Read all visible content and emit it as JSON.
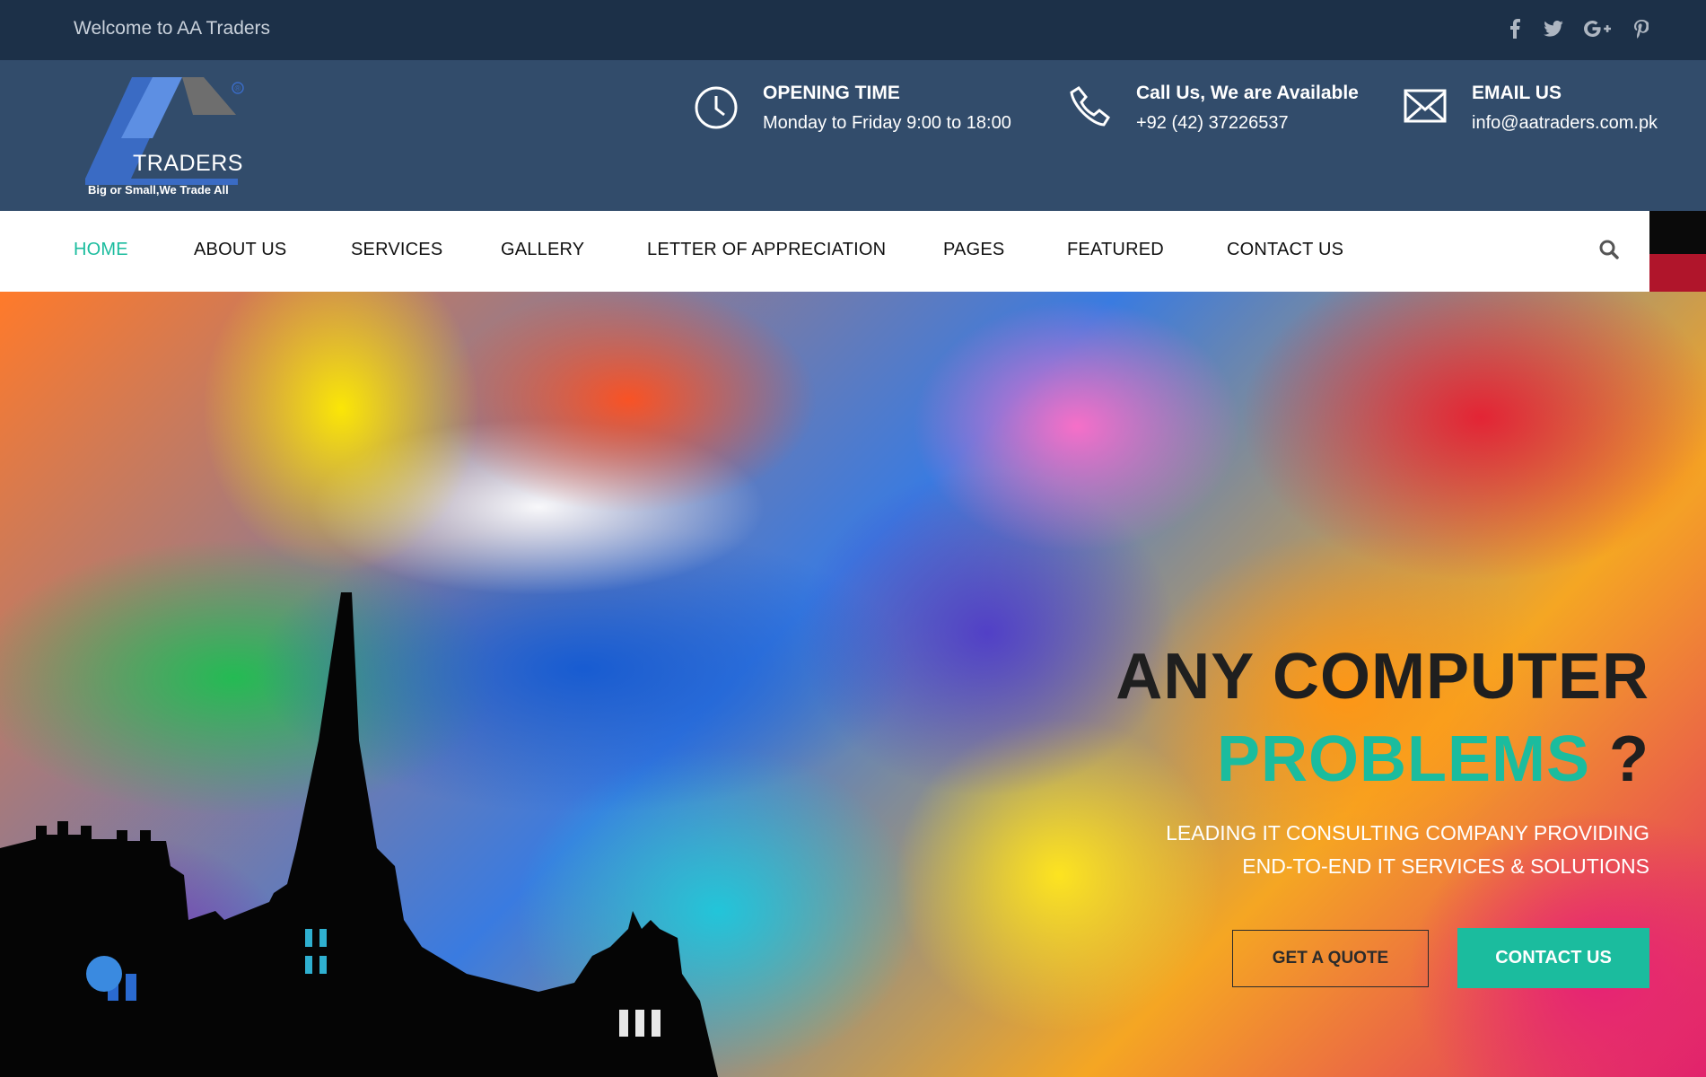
{
  "topbar": {
    "welcome": "Welcome to AA Traders",
    "social": [
      "facebook-icon",
      "twitter-icon",
      "google-plus-icon",
      "pinterest-icon"
    ]
  },
  "logo": {
    "name": "TRADERS",
    "tagline": "Big or Small,We Trade All",
    "registered": "®"
  },
  "contacts": [
    {
      "icon": "clock-icon",
      "title": "OPENING TIME",
      "text": "Monday to Friday 9:00 to 18:00"
    },
    {
      "icon": "phone-icon",
      "title": "Call Us, We are Available",
      "text": "+92 (42) 37226537"
    },
    {
      "icon": "envelope-icon",
      "title": "EMAIL US",
      "text": "info@aatraders.com.pk"
    }
  ],
  "nav": {
    "items": [
      "HOME",
      "ABOUT US",
      "SERVICES",
      "GALLERY",
      "LETTER OF APPRECIATION",
      "PAGES",
      "FEATURED",
      "CONTACT US"
    ],
    "active": "HOME"
  },
  "hero": {
    "title_line1": "ANY COMPUTER",
    "title_line2": "PROBLEMS",
    "title_q": "?",
    "subtitle_line1": "LEADING IT CONSULTING COMPANY PROVIDING",
    "subtitle_line2": "END-TO-END IT SERVICES & SOLUTIONS",
    "btn_quote": "GET A QUOTE",
    "btn_contact": "CONTACT US"
  },
  "colors": {
    "topbar": "#1c3048",
    "header": "#324c6b",
    "accent": "#1bbc9e",
    "nav_edge": "#b0152b"
  }
}
